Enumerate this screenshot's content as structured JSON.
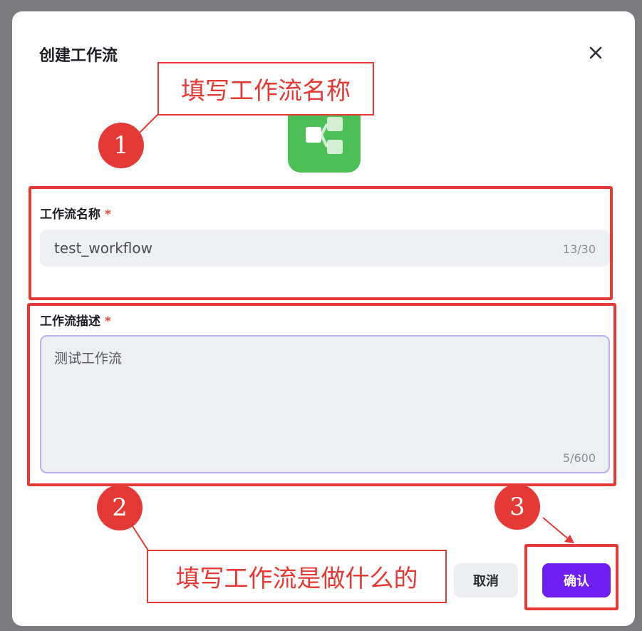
{
  "dialog": {
    "title": "创建工作流",
    "close_icon": "close-icon",
    "app_icon": "workflow-icon",
    "name_field": {
      "label": "工作流名称",
      "required_mark": "*",
      "value": "test_workflow",
      "counter": "13/30"
    },
    "desc_field": {
      "label": "工作流描述",
      "required_mark": "*",
      "value": "测试工作流",
      "counter": "5/600"
    },
    "buttons": {
      "cancel": "取消",
      "confirm": "确认"
    }
  },
  "annotations": {
    "callout_1": "填写工作流名称",
    "callout_2": "填写工作流是做什么的",
    "step_1": "1",
    "step_2": "2",
    "step_3": "3"
  },
  "colors": {
    "accent": "#6d1ff1",
    "icon_bg": "#4cbf56",
    "annotation_red": "#e53935"
  }
}
